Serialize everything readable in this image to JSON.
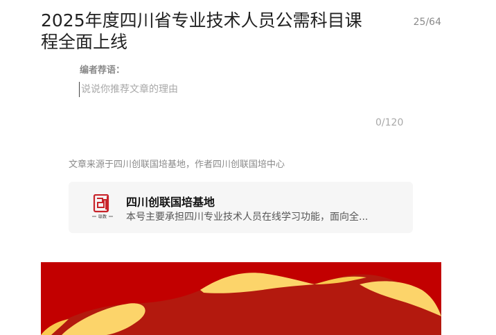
{
  "article": {
    "title": "2025年度四川省专业技术人员公需科目课程全面上线",
    "title_count": "25/64"
  },
  "editor_note": {
    "label": "编者荐语：",
    "placeholder": "说说你推荐文章的理由",
    "counter": "0/120"
  },
  "source": {
    "text": "文章来源于四川创联国培基地，作者四川创联国培中心"
  },
  "account_card": {
    "name": "四川创联国培基地",
    "description": "本号主要承担四川专业技术人员在线学习功能，面向全...",
    "logo_icon": "account-logo-icon",
    "logo_text": "联教"
  },
  "colors": {
    "banner_red": "#c20000",
    "banner_dark_red": "#b3190e",
    "banner_gold": "#fcd46a",
    "logo_red": "#c8242b"
  }
}
